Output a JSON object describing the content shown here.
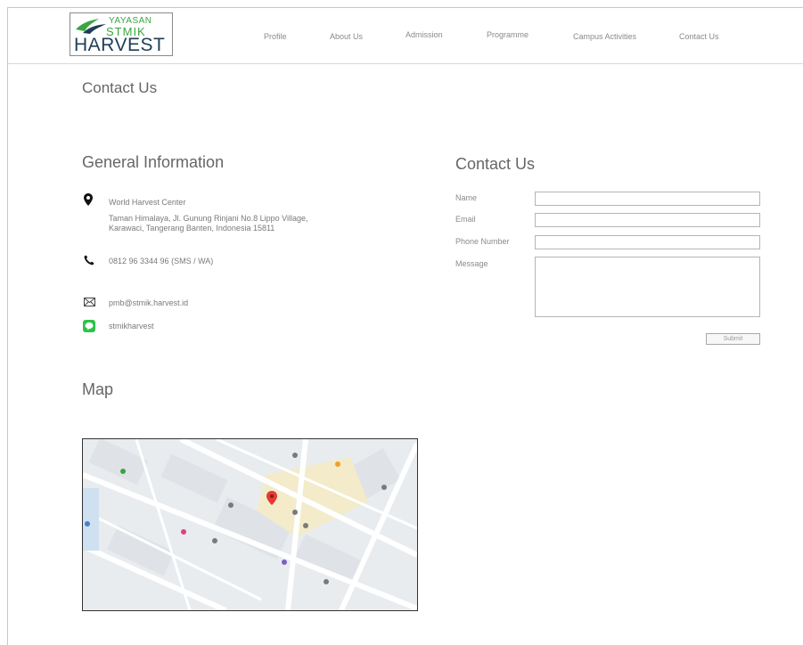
{
  "logo": {
    "line1": "YAYASAN",
    "line2": "STMIK",
    "line3": "HARVEST"
  },
  "nav": [
    "Profile",
    "About Us",
    "Admission",
    "Programme",
    "Campus Activities",
    "Contact Us"
  ],
  "page_title": "Contact Us",
  "general": {
    "heading": "General Information",
    "address_name": "World Harvest Center",
    "address_line1": "Taman Himalaya, Jl. Gunung Rinjani No.8 Lippo Village,",
    "address_line2": "Karawaci, Tangerang Banten, Indonesia 15811",
    "phone": "0812 96 3344 96 (SMS / WA)",
    "email": "pmb@stmik.harvest.id",
    "line_id": "stmikharvest"
  },
  "form": {
    "heading": "Contact Us",
    "name_label": "Name",
    "email_label": "Email",
    "phone_label": "Phone Number",
    "message_label": "Message",
    "submit_label": "Submit"
  },
  "map": {
    "heading": "Map"
  },
  "colors": {
    "brand_green": "#3aa640",
    "brand_navy": "#1f3e57",
    "line_green": "#2ec14a"
  }
}
